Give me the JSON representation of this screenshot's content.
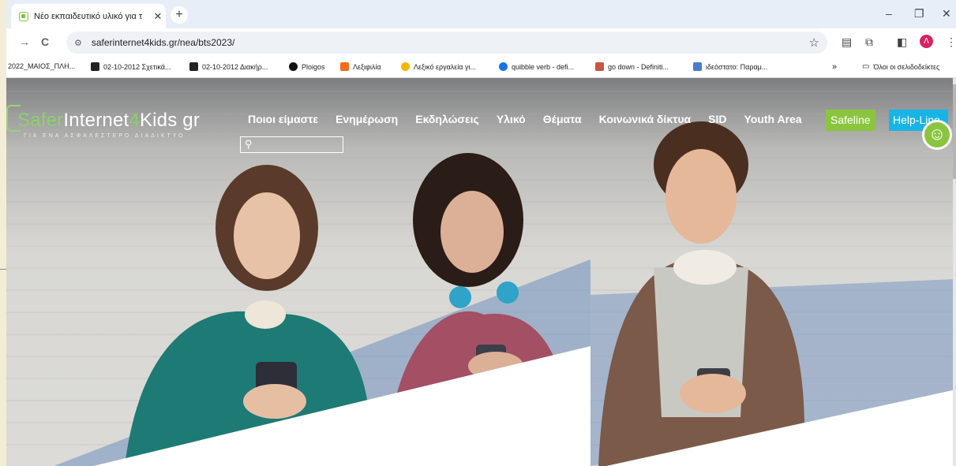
{
  "tab": {
    "title": "Νέο εκπαιδευτικό υλικό για τ",
    "close": "✕",
    "new": "+"
  },
  "window": {
    "minimize": "–",
    "maximize": "❐",
    "close": "✕"
  },
  "address": {
    "url": "saferinternet4kids.gr/nea/bts2023/",
    "back": "→",
    "reload": "C"
  },
  "bookmarks": [
    {
      "label": "2022_ΜΑΙΟΣ_ΠΛΗ...",
      "color": ""
    },
    {
      "label": "02-10-2012 Σχετικά...",
      "color": "#222222"
    },
    {
      "label": "02-10-2012 Διακήρ...",
      "color": "#222222"
    },
    {
      "label": "Ploigos",
      "color": "#111111"
    },
    {
      "label": "Λεξιφιλία",
      "color": "#f26b1d"
    },
    {
      "label": "Λεξικό εργαλεία γι...",
      "color": "#f2b705"
    },
    {
      "label": "quibble verb - defi...",
      "color": "#1a73e8"
    },
    {
      "label": "go down - Definiti...",
      "color": "#c8553d"
    },
    {
      "label": "ιδεόστατο: Παραμ...",
      "color": "#4a7bd0"
    }
  ],
  "bookmarks_more": "»",
  "bookmarks_all": "Όλοι οι σελιδοδείκτες",
  "avatar": "Λ",
  "site": {
    "logo": {
      "part1": "Safer",
      "part2": "Internet",
      "part3": "4",
      "part4": "Kids",
      "part5": " gr",
      "tagline": "ΓΙΑ ΕΝΑ ΑΣΦΑΛΕΣΤΕΡΟ ΔΙΑΔΙΚΤΥΟ"
    },
    "menu": [
      "Ποιοι είμαστε",
      "Ενημέρωση",
      "Εκδηλώσεις",
      "Υλικό",
      "Θέματα",
      "Κοινωνικά δίκτυα",
      "SID",
      "Youth Area"
    ],
    "safeline": "Safeline",
    "helpline": "Help-Line",
    "search_placeholder": ""
  },
  "colors": {
    "green": "#8bc53f",
    "blue": "#19b4e6",
    "overlay": "#6f8fc0"
  }
}
